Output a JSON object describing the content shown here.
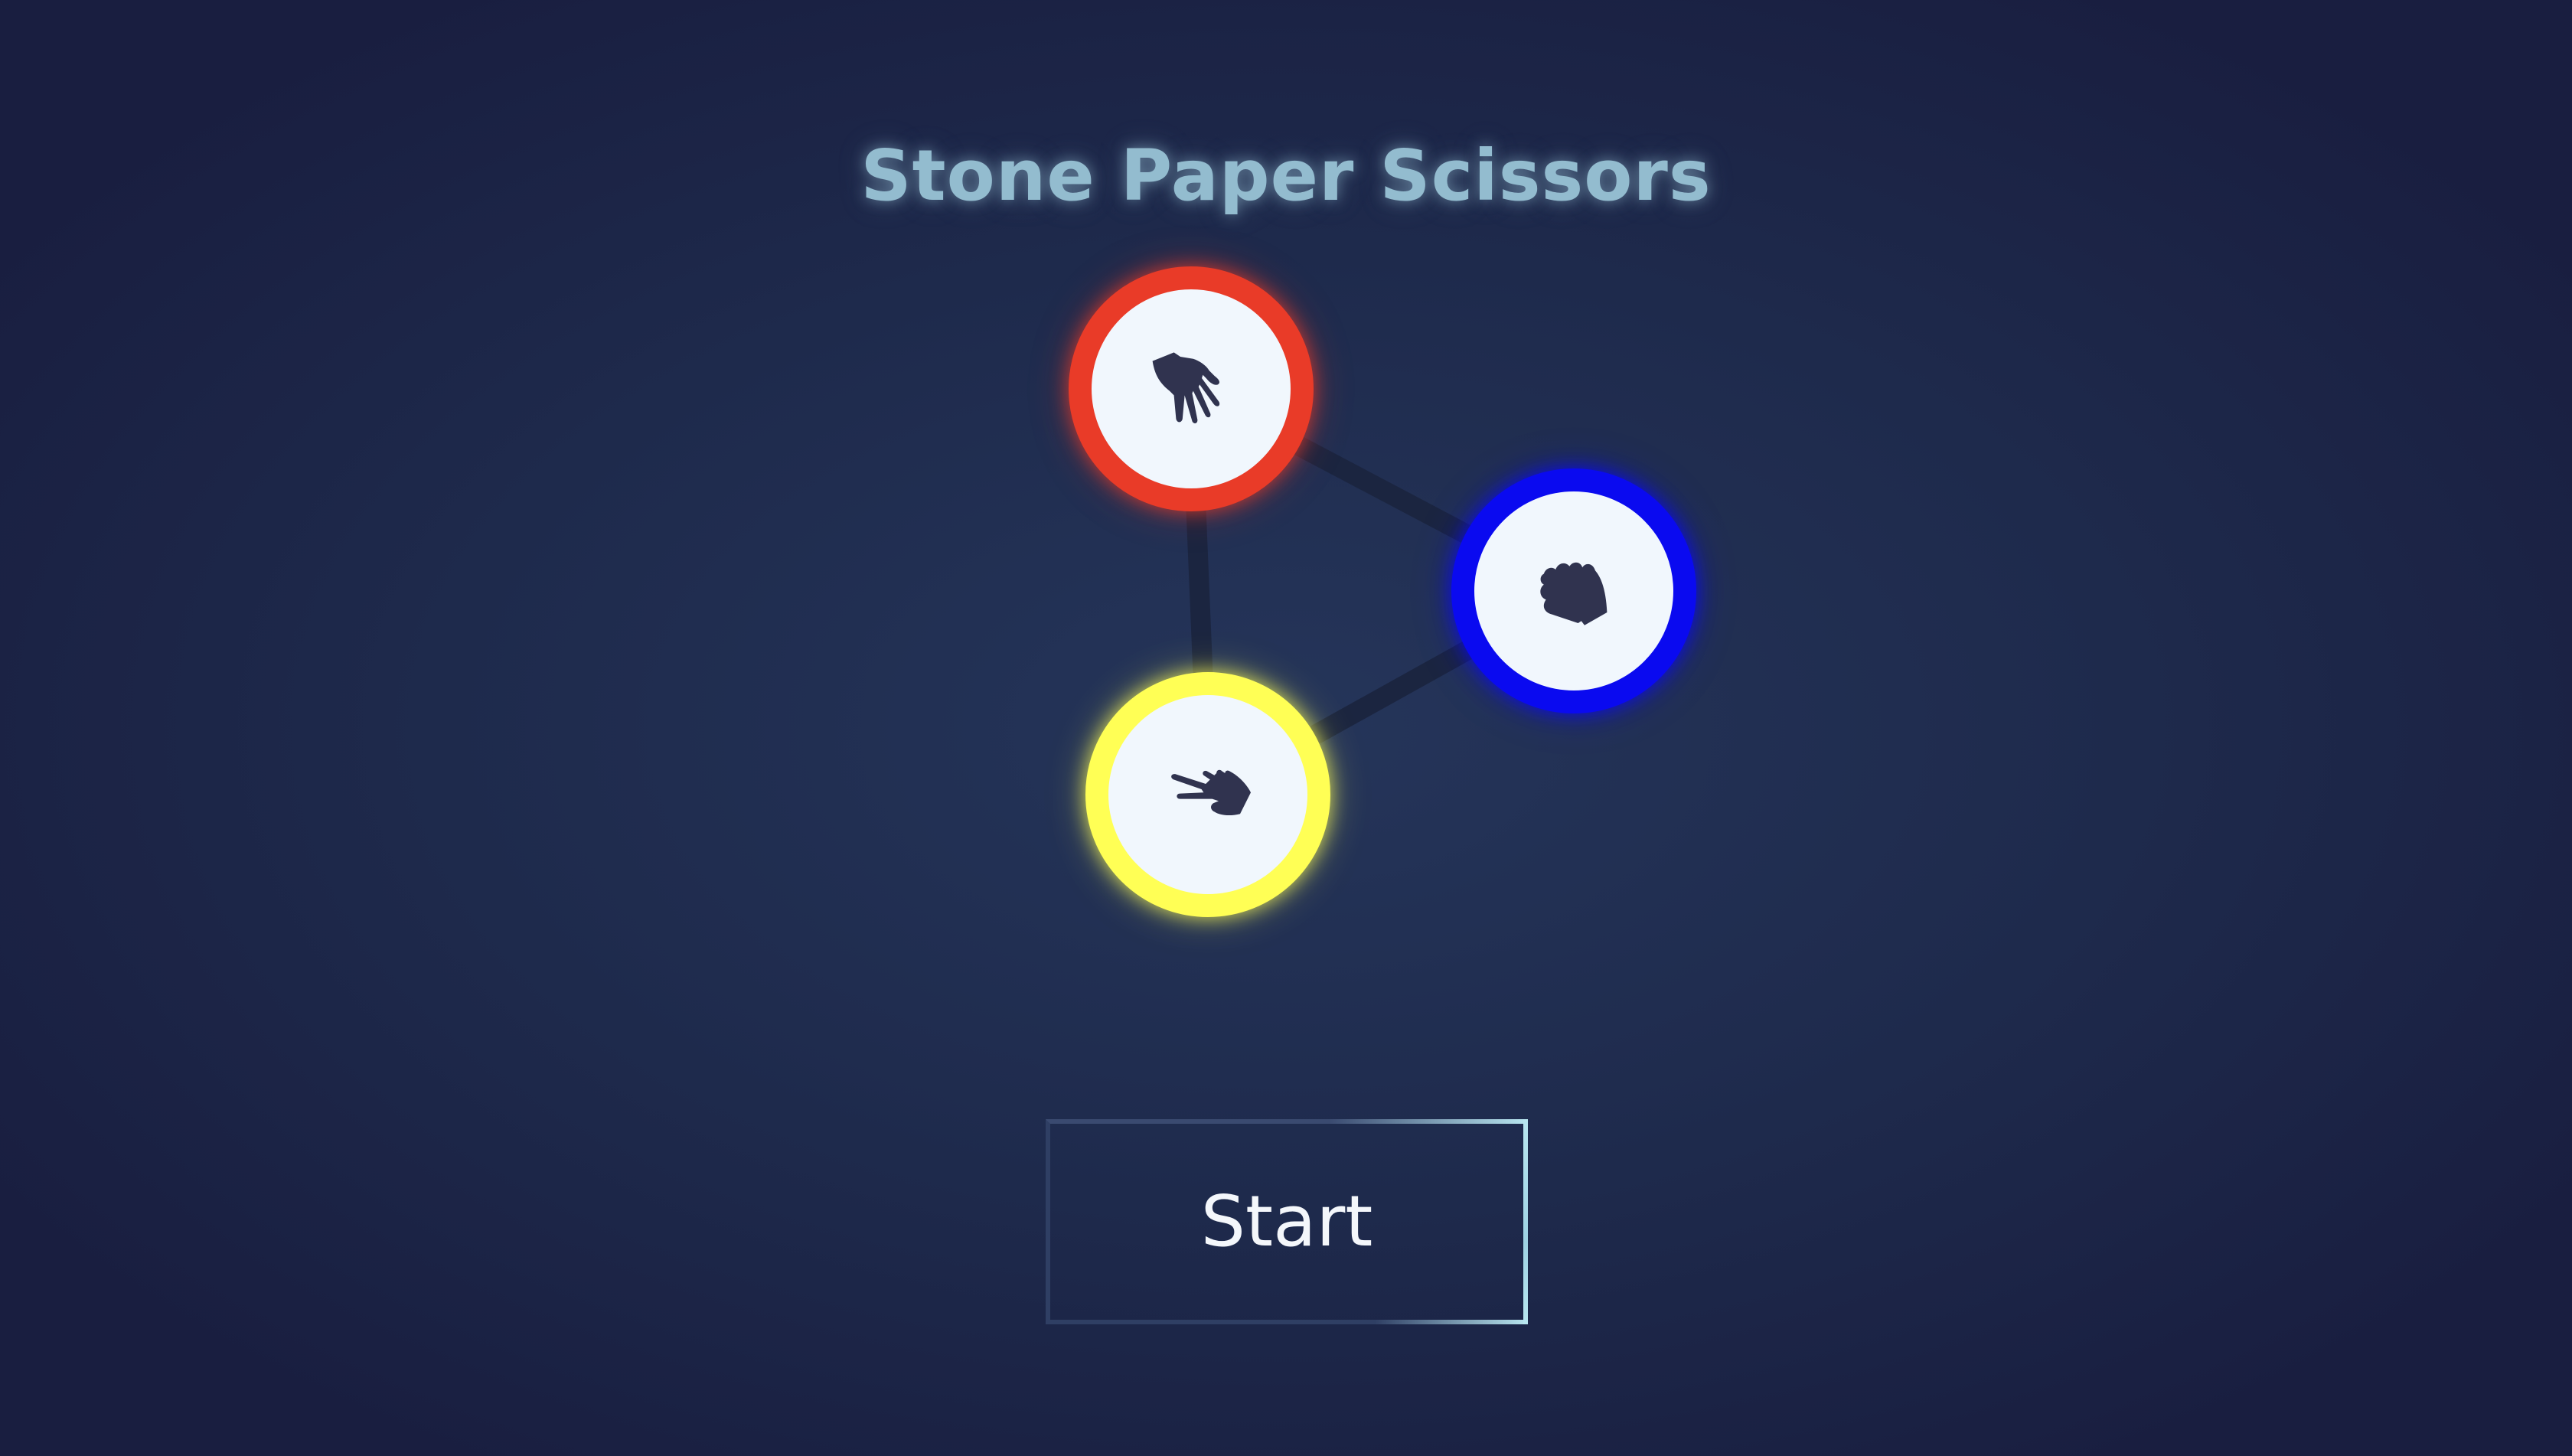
{
  "game": {
    "title": "Stone Paper Scissors",
    "start_label": "Start",
    "choices": [
      {
        "id": "paper",
        "icon": "paper-hand-icon",
        "ring_color": "#e93b28"
      },
      {
        "id": "stone",
        "icon": "stone-fist-icon",
        "ring_color": "#0a0af0"
      },
      {
        "id": "scissors",
        "icon": "scissors-hand-icon",
        "ring_color": "#ffff55"
      }
    ]
  },
  "colors": {
    "background": "#1e2a4c",
    "title": "#93bccf",
    "icon": "#30334f",
    "connector": "#1b2540",
    "button_text": "#f4f7fb",
    "button_accent": "#b8e6f0"
  }
}
